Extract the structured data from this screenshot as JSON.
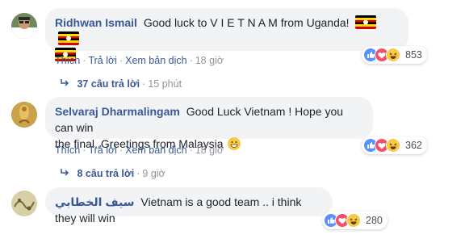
{
  "comments": [
    {
      "author": "Ridhwan Ismail",
      "text": "Good luck to V I E T N A M from Uganda!",
      "flag_name": "uganda-flag",
      "actions": {
        "like": "Thích",
        "reply": "Trả lời",
        "translate": "Xem bản dịch",
        "time": "18 giờ"
      },
      "reaction_count": "853",
      "replies": {
        "label": "37 câu trả lời",
        "time": "15 phút"
      }
    },
    {
      "author": "Selvaraj Dharmalingam",
      "text_line1": "Good Luck Vietnam ! Hope you can win",
      "text_line2": "the final..Greetings from Malaysia",
      "actions": {
        "like": "Thích",
        "reply": "Trả lời",
        "translate": "Xem bản dịch",
        "time": "18 giờ"
      },
      "reaction_count": "362",
      "replies": {
        "label": "8 câu trả lời",
        "time": "9 giờ"
      }
    },
    {
      "author": "سيف الخطابي",
      "text": "Vietnam is a good team .. i think they will win",
      "reaction_count": "280"
    }
  ],
  "colors": {
    "link": "#385898",
    "bubble": "#f2f3f5",
    "like": "#5890ff",
    "love": "#f25268",
    "haha": "#f7c944",
    "meta": "#90949c"
  }
}
